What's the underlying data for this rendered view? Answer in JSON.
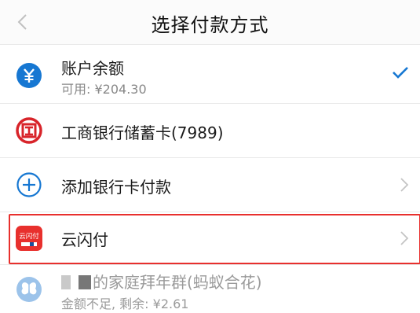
{
  "header": {
    "title": "选择付款方式",
    "back_icon": "chevron-left-icon"
  },
  "methods": [
    {
      "label": "账户余额",
      "sub": "可用: ¥204.30",
      "selected": true,
      "icon": "yen-icon",
      "icon_color": "#1677d2"
    },
    {
      "label": "工商银行储蓄卡(7989)",
      "selected": false,
      "icon": "icbc-logo-icon",
      "icon_color": "#d8242a"
    },
    {
      "label": "添加银行卡付款",
      "selected": false,
      "icon": "plus-circle-icon",
      "icon_color": "#1677d2"
    },
    {
      "label": "云闪付",
      "selected": false,
      "icon": "unionpay-quickpass-icon",
      "icon_color": "#e8302d",
      "logo_text": "云闪付"
    },
    {
      "label": "的家庭拜年群(蚂蚁合花)",
      "sub": "金额不足, 剩余: ¥2.61",
      "selected": false,
      "icon": "butterfly-icon",
      "icon_color": "#9cc3ea",
      "disabled": true
    }
  ],
  "colors": {
    "accent": "#1677d2",
    "highlight": "#e8302d"
  }
}
